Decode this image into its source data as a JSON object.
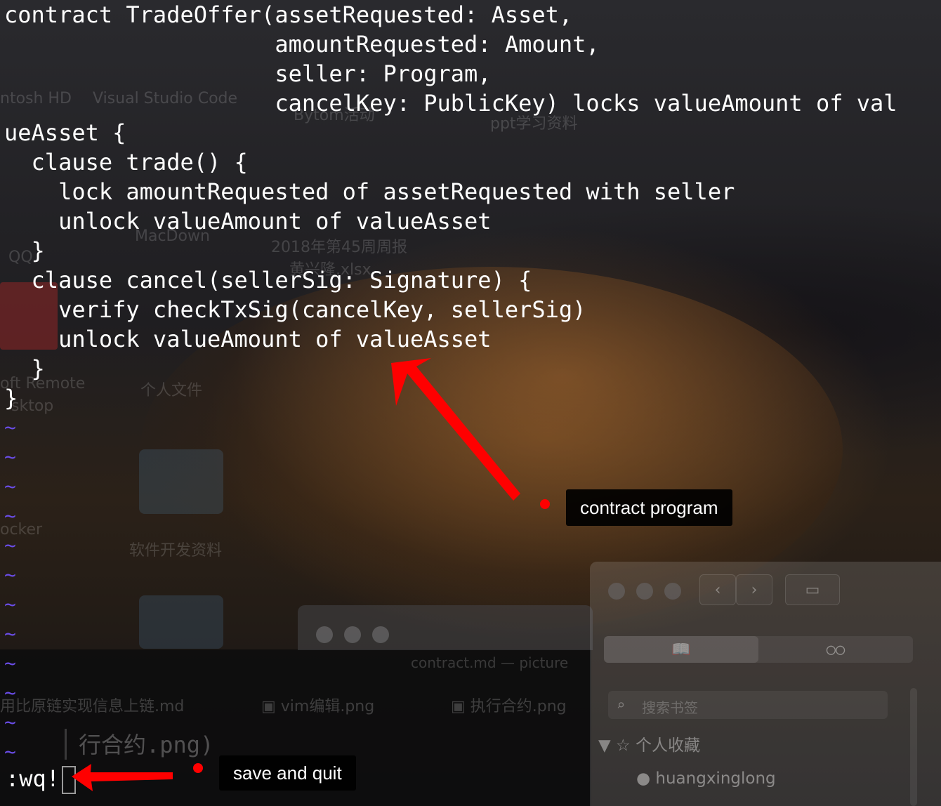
{
  "vim": {
    "lines": [
      "contract TradeOffer(assetRequested: Asset,",
      "                    amountRequested: Amount,",
      "                    seller: Program,",
      "                    cancelKey: PublicKey) locks valueAmount of val",
      "ueAsset {",
      "  clause trade() {",
      "    lock amountRequested of assetRequested with seller",
      "    unlock valueAmount of valueAsset",
      "  }",
      "  clause cancel(sellerSig: Signature) {",
      "    verify checkTxSig(cancelKey, sellerSig)",
      "    unlock valueAmount of valueAsset",
      "  }",
      "}"
    ],
    "tilde": "~",
    "command": ":wq!"
  },
  "annotations": {
    "contract_label": "contract program",
    "save_label": "save and quit",
    "color": "#ff0000"
  },
  "background": {
    "desktop_labels": [
      "ntosh HD",
      "Visual Studio Code",
      "Bytom活动",
      "ppt学习资料",
      "QQ",
      "MacDown",
      "2018年第45周周报",
      "黄兴隆.xlsx",
      "oft Remote",
      "sktop",
      "个人文件",
      "ocker",
      "软件开发资料"
    ],
    "window_title": "contract.md — picture",
    "tabs": [
      "用比原链实现信息上链.md",
      "vim编辑.png",
      "执行合约.png"
    ],
    "doc_text": "行合约.png)"
  },
  "sidebar": {
    "search_placeholder": "搜索书签",
    "favorites_label": "个人收藏",
    "favorites_item": "huangxinglong"
  }
}
